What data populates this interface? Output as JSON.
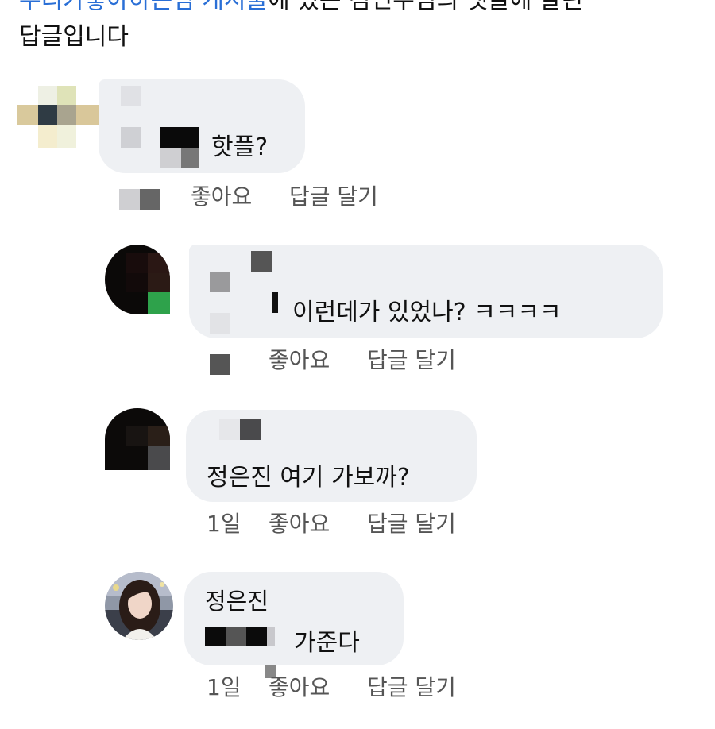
{
  "header": {
    "line1_prefix": "우리가좋아",
    "line1_link_user": "하는님",
    "line1_link_post": "게시물",
    "line1_rest": "에 있는 김민수님의 댓글에 달린",
    "line2": "답글입니다"
  },
  "comments": [
    {
      "author": "",
      "text": "핫플?",
      "time": "",
      "like_label": "좋아요",
      "reply_label": "답글 달기"
    },
    {
      "author": "",
      "text": "이런데가 있었나? ㅋㅋㅋㅋ",
      "time": "",
      "like_label": "좋아요",
      "reply_label": "답글 달기"
    },
    {
      "author": "",
      "text": "정은진 여기 가보까?",
      "time": "1일",
      "like_label": "좋아요",
      "reply_label": "답글 달기"
    },
    {
      "author": "정은진",
      "text": "가준다",
      "time": "1일",
      "like_label": "좋아요",
      "reply_label": "답글 달기"
    }
  ]
}
